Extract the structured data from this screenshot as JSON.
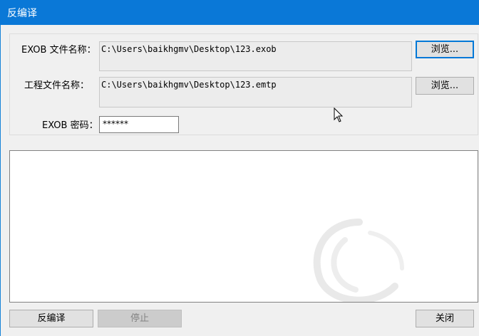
{
  "window": {
    "title": "反编译"
  },
  "form": {
    "exob_label": "EXOB 文件名称：",
    "exob_path": "C:\\Users\\baikhgmv\\Desktop\\123.exob",
    "browse_exob_label": "浏览...",
    "project_label": "工程文件名称：",
    "project_path": "C:\\Users\\baikhgmv\\Desktop\\123.emtp",
    "browse_project_label": "浏览...",
    "password_label": "EXOB 密码：",
    "password_value": "******"
  },
  "output": {
    "text": ""
  },
  "footer": {
    "decompile_label": "反编译",
    "stop_label": "停止",
    "close_label": "关闭"
  },
  "colors": {
    "titlebar": "#0a78d7",
    "focus_border": "#0078d7"
  },
  "icons": [
    "pointer-cursor-icon",
    "watermark-logo-icon"
  ]
}
